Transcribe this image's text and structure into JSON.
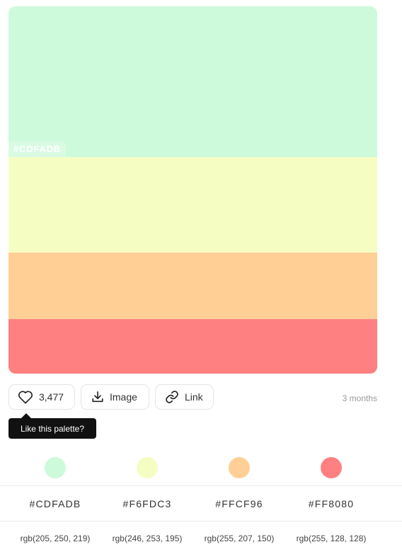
{
  "palette": {
    "colors": [
      {
        "hex": "#CDFADB",
        "rgb": "rgb(205, 250, 219)"
      },
      {
        "hex": "#F6FDC3",
        "rgb": "rgb(246, 253, 195)"
      },
      {
        "hex": "#FFCF96",
        "rgb": "rgb(255, 207, 150)"
      },
      {
        "hex": "#FF8080",
        "rgb": "rgb(255, 128, 128)"
      }
    ],
    "hover_label": "#CDFADB"
  },
  "actions": {
    "like_count": "3,477",
    "image_label": "Image",
    "link_label": "Link",
    "time_ago": "3 months"
  },
  "tooltip": {
    "text": "Like this palette?"
  },
  "icons": {
    "like": "heart-icon",
    "image": "download-icon",
    "link": "link-icon"
  }
}
